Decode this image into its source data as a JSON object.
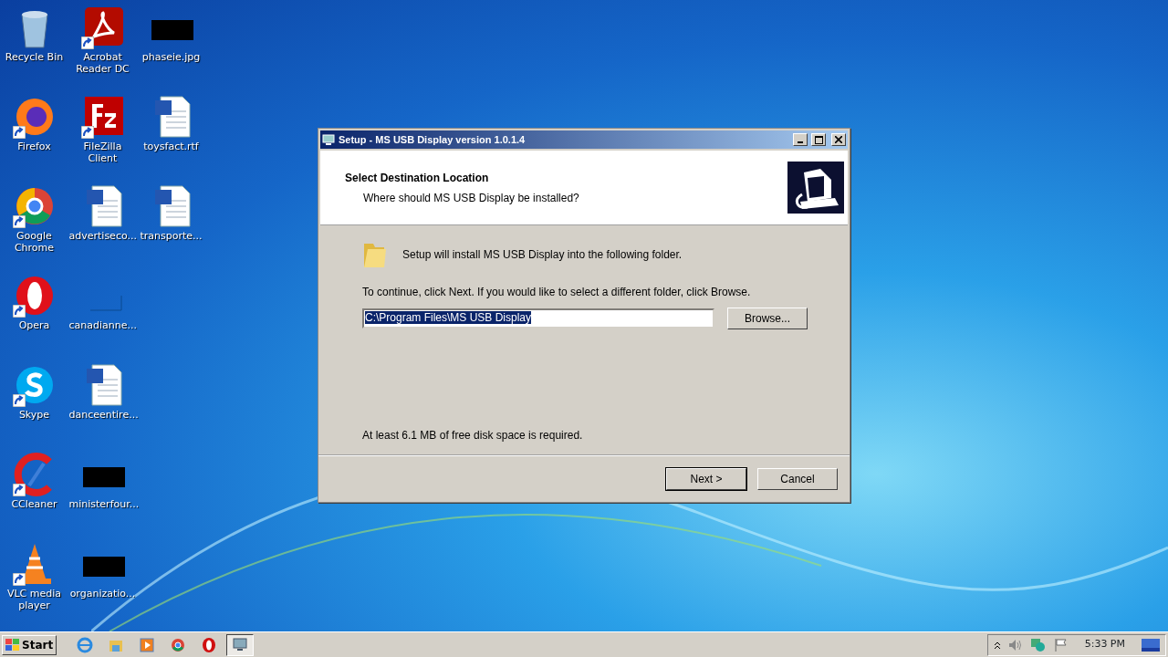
{
  "desktop_icons": [
    {
      "label": "Recycle Bin",
      "kind": "recycle",
      "shortcut": false
    },
    {
      "label": "Acrobat Reader DC",
      "kind": "acrobat",
      "shortcut": true
    },
    {
      "label": "phaseie.jpg",
      "kind": "redacted",
      "shortcut": false
    },
    {
      "label": "Firefox",
      "kind": "firefox",
      "shortcut": true
    },
    {
      "label": "FileZilla Client",
      "kind": "filezilla",
      "shortcut": true
    },
    {
      "label": "toysfact.rtf",
      "kind": "word",
      "shortcut": false
    },
    {
      "label": "Google Chrome",
      "kind": "chrome",
      "shortcut": true
    },
    {
      "label": "advertiseco...",
      "kind": "word",
      "shortcut": false
    },
    {
      "label": "transporte...",
      "kind": "word",
      "shortcut": false
    },
    {
      "label": "Opera",
      "kind": "opera",
      "shortcut": true
    },
    {
      "label": "canadianne...",
      "kind": "blank",
      "shortcut": false
    },
    {
      "kind": "none"
    },
    {
      "label": "Skype",
      "kind": "skype",
      "shortcut": true
    },
    {
      "label": "danceentire...",
      "kind": "word",
      "shortcut": false
    },
    {
      "kind": "none"
    },
    {
      "label": "CCleaner",
      "kind": "ccleaner",
      "shortcut": true
    },
    {
      "label": "ministerfour...",
      "kind": "redacted",
      "shortcut": false
    },
    {
      "kind": "none"
    },
    {
      "label": "VLC media player",
      "kind": "vlc",
      "shortcut": true
    },
    {
      "label": "organizatio...",
      "kind": "redacted",
      "shortcut": false
    }
  ],
  "window": {
    "title": "Setup - MS USB Display version 1.0.1.4",
    "header": {
      "title": "Select Destination Location",
      "subtitle": "Where should MS USB Display be installed?"
    },
    "intro": "Setup will install MS USB Display into the following folder.",
    "instruction": "To continue, click Next. If you would like to select a different folder, click Browse.",
    "path": {
      "value": "C:\\Program Files\\MS USB Display",
      "selected": true
    },
    "browse_button": "Browse...",
    "disk_space": "At least 6.1 MB of free disk space is required.",
    "buttons": [
      {
        "label": "Next >",
        "default": true
      },
      {
        "label": "Cancel",
        "default": false
      }
    ]
  },
  "taskbar": {
    "start": "Start",
    "apps": [
      {
        "kind": "ie",
        "active": false
      },
      {
        "kind": "explorer",
        "active": false
      },
      {
        "kind": "media",
        "active": false
      },
      {
        "kind": "chrome",
        "active": false
      },
      {
        "kind": "opera",
        "active": false
      },
      {
        "kind": "setup",
        "active": true
      }
    ],
    "clock": "5:33 PM"
  }
}
